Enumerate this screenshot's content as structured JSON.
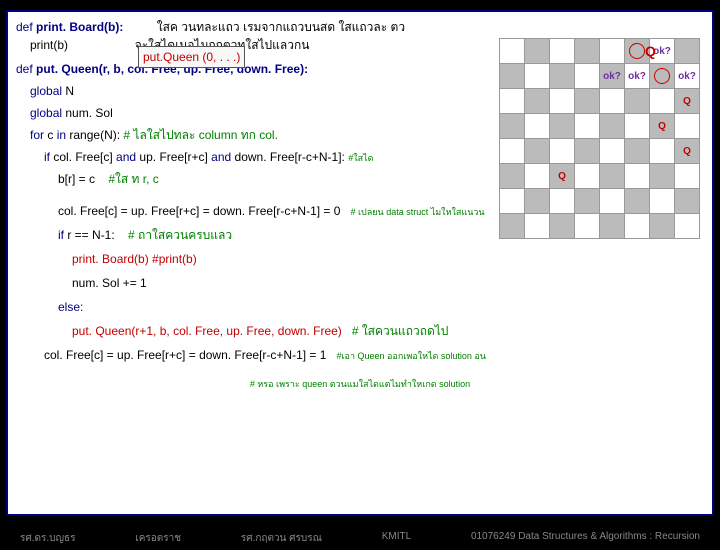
{
  "line1a": "def",
  "line1b": "print. Board(b):",
  "line1c": "ใสค วนทละแถว     เรมจากแถวบนสด     ใสแถวละ  ตว",
  "line2a": "print(b)",
  "line2b": "จะใสไดเมอไมถกตวทใสไปแลวกน",
  "line2c": "put.Queen (0, . . .)",
  "line3a": "def",
  "line3b": "put. Queen(r, b, col. Free, up. Free, down. Free):",
  "line4a": "global",
  "line4b": "N",
  "line5a": "global",
  "line5b": "num. Sol",
  "line6a": "for",
  "line6b": "c",
  "line6c": "in",
  "line6d": "range(N):",
  "line6e": "# ไลใสไปทละ        column ทก   col.",
  "line7a": "if",
  "line7b": "col. Free[c]",
  "line7c": "and",
  "line7d": "up. Free[r+c]",
  "line7e": "and",
  "line7f": "down. Free[r-c+N-1]:",
  "line7g": "#ใสได",
  "line8a": "b[r] = c",
  "line8b": "#ใส   ท       r, c",
  "line9a": "col. Free[c] = up. Free[r+c] = down. Free[r-c+N-1] = 0",
  "line9b": "# เปลยน     data struct ไมใหใสแนวน",
  "line10a": "if",
  "line10b": "r == N-1:",
  "line10c": "# ถาใสควนครบแลว",
  "line11a": "print. Board(b) #print(b)",
  "line12a": "num. Sol += 1",
  "line13a": "else:",
  "line14a": "put. Queen(r+1, b, col. Free, up. Free, down. Free)",
  "line14b": "# ใสควนแถวถดไป",
  "line15a": "col. Free[c] = up. Free[r+c] = down. Free[r-c+N-1] = 1",
  "line15b": "#เอา Queen ออกเพอใหได            solution อน",
  "line16a": "# หรอ    เพราะ queen ตวนแมใสไดแตไมทำใหเกด                solution",
  "q": "Q",
  "ok": "ok?",
  "foot1": "รศ.ดร.บญธร",
  "foot2": "เครอตราช",
  "foot3": "รศ.กฤตวน  ศรบรณ",
  "foot4": "KMITL",
  "foot5": "01076249 Data Structures & Algorithms : Recursion"
}
